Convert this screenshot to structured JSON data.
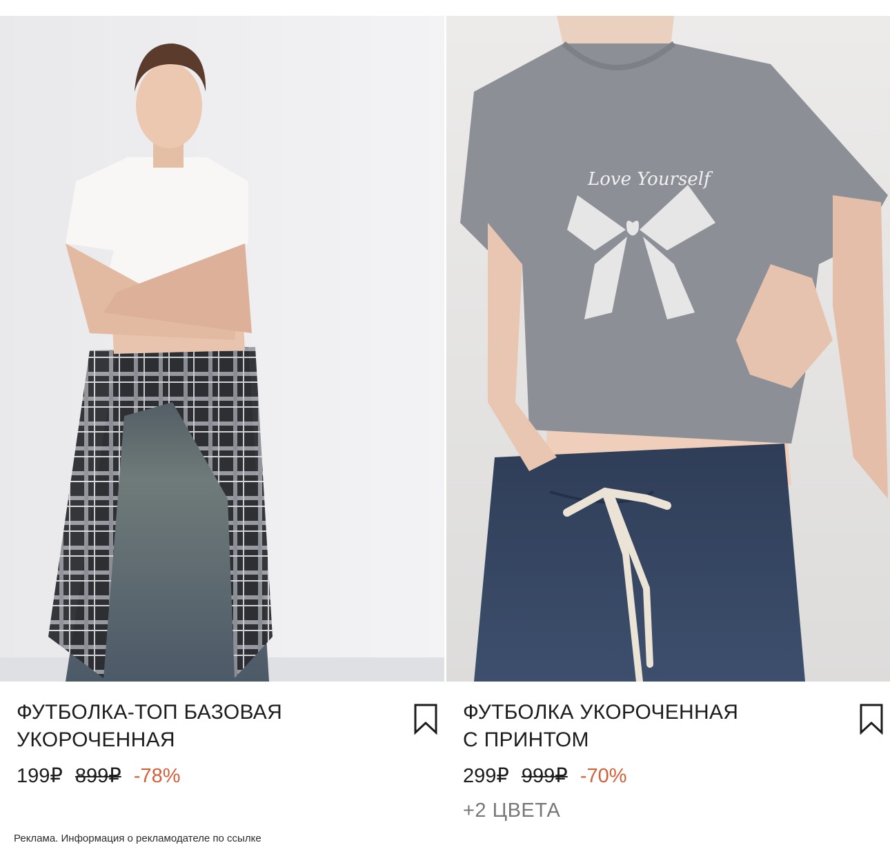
{
  "products": [
    {
      "title_line1": "ФУТБОЛКА-ТОП БАЗОВАЯ",
      "title_line2": "УКОРОЧЕННАЯ",
      "price": "199₽",
      "old_price": "899₽",
      "discount": "-78%",
      "image_alt": "model in white cropped t-shirt with plaid shirt tied at waist",
      "bookmark_icon": "bookmark-outline-icon"
    },
    {
      "title_line1": "ФУТБОЛКА УКОРОЧЕННАЯ",
      "title_line2": "С ПРИНТОМ",
      "price": "299₽",
      "old_price": "999₽",
      "discount": "-70%",
      "colors_more": "+2 ЦВЕТА",
      "print_text": "Love Yourself",
      "image_alt": "model in grey cropped t-shirt with bow print",
      "bookmark_icon": "bookmark-outline-icon"
    }
  ],
  "ad_disclaimer": "Реклама. Информация о рекламодателе по ссылке",
  "colors": {
    "discount": "#d2603a",
    "text": "#1c1c1c",
    "muted": "#777777"
  }
}
